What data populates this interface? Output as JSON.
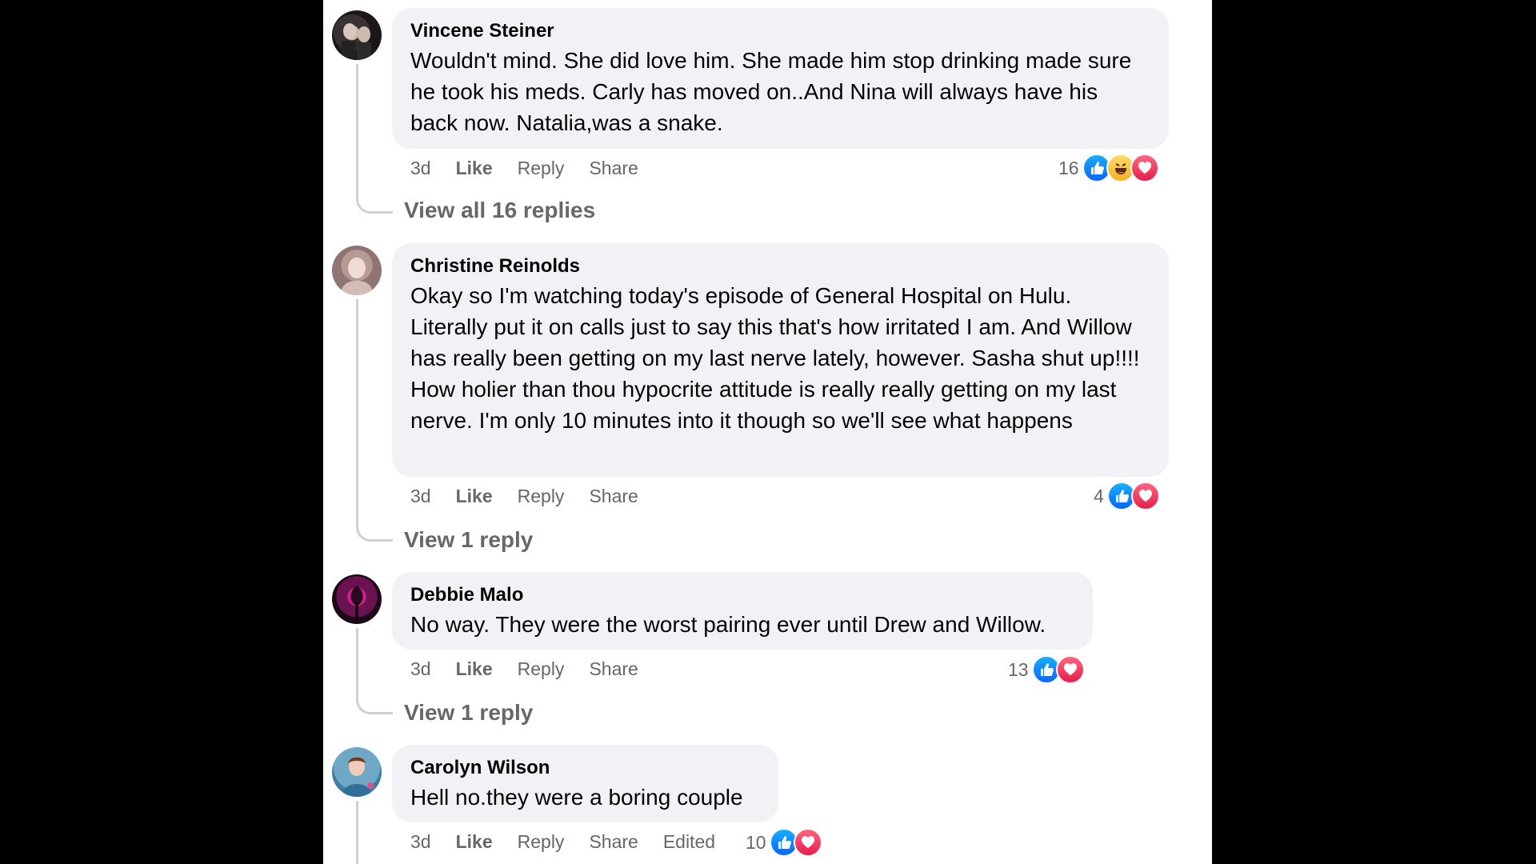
{
  "comments": [
    {
      "author": "Vincene Steiner",
      "text": "Wouldn't mind. She did love him. She made him stop drinking made sure he took his meds. Carly has moved on..And Nina will always have his back now. Natalia,was a snake.",
      "time": "3d",
      "like": "Like",
      "reply": "Reply",
      "share": "Share",
      "reaction_count": "16",
      "reactions": [
        "like-icon",
        "haha-icon",
        "love-icon"
      ],
      "view_replies": "View all 16 replies"
    },
    {
      "author": "Christine Reinolds",
      "text": "Okay so I'm watching today's episode of General Hospital on Hulu. Literally put it on calls just to say this that's how irritated I am. And Willow has really been getting on my last nerve lately, however. Sasha shut up!!!! How holier than thou hypocrite attitude is really really getting on my last nerve. I'm only 10 minutes into it though so we'll see what happens",
      "time": "3d",
      "like": "Like",
      "reply": "Reply",
      "share": "Share",
      "reaction_count": "4",
      "reactions": [
        "like-icon",
        "love-icon"
      ],
      "view_replies": "View 1 reply"
    },
    {
      "author": "Debbie Malo",
      "text": "No way. They were the worst pairing ever until Drew and Willow.",
      "time": "3d",
      "like": "Like",
      "reply": "Reply",
      "share": "Share",
      "reaction_count": "13",
      "reactions": [
        "like-icon",
        "love-icon"
      ],
      "view_replies": "View 1 reply"
    },
    {
      "author": "Carolyn Wilson",
      "text": "Hell no.they were a boring couple",
      "time": "3d",
      "like": "Like",
      "reply": "Reply",
      "share": "Share",
      "edited": "Edited",
      "reaction_count": "10",
      "reactions": [
        "like-icon",
        "love-icon"
      ]
    }
  ],
  "colors": {
    "bubble": "#f0f2f5",
    "like_blue": "#0866ff",
    "love_red": "#e61e4d",
    "meta_gray": "#65676b"
  }
}
